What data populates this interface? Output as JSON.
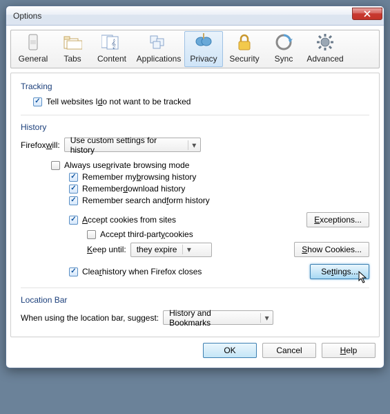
{
  "window": {
    "title": "Options"
  },
  "tabs": {
    "general": "General",
    "tabs": "Tabs",
    "content": "Content",
    "applications": "Applications",
    "privacy": "Privacy",
    "security": "Security",
    "sync": "Sync",
    "advanced": "Advanced"
  },
  "tracking": {
    "title": "Tracking",
    "dnt_pre": "Tell websites I ",
    "dnt_u": "d",
    "dnt_post": "o not want to be tracked"
  },
  "history": {
    "title": "History",
    "firefox_pre": "Firefox ",
    "firefox_u": "w",
    "firefox_post": "ill:",
    "mode_value": "Use custom settings for history",
    "private_pre": "Always use ",
    "private_u": "p",
    "private_post": "rivate browsing mode",
    "rem_browse_pre": "Remember my ",
    "rem_browse_u": "b",
    "rem_browse_post": "rowsing history",
    "rem_down_pre": "Remember ",
    "rem_down_u": "d",
    "rem_down_post": "ownload history",
    "rem_search_pre": "Remember search and ",
    "rem_search_u": "f",
    "rem_search_post": "orm history",
    "accept_u": "A",
    "accept_post": "ccept cookies from sites",
    "exceptions_u": "E",
    "exceptions_post": "xceptions...",
    "third_pre": "Accept third-part",
    "third_u": "y",
    "third_post": " cookies",
    "keep_u": "K",
    "keep_post": "eep until:",
    "keep_value": "they expire",
    "show_u": "S",
    "show_post": "how Cookies...",
    "clear_pre": "Clea",
    "clear_u": "r",
    "clear_post": " history when Firefox closes",
    "settings_pre": "Se",
    "settings_u": "t",
    "settings_post": "tings..."
  },
  "location": {
    "title": "Location Bar",
    "label": "When using the location bar, suggest:",
    "value": "History and Bookmarks"
  },
  "footer": {
    "ok": "OK",
    "cancel": "Cancel",
    "help_u": "H",
    "help_post": "elp"
  }
}
